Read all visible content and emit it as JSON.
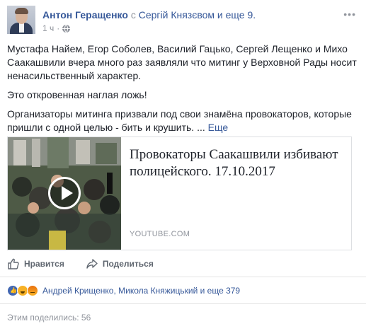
{
  "header": {
    "author": "Антон Геращенко",
    "with_text": "с",
    "tagged": "Сергій Князєвом и еще 9.",
    "time": "1 ч",
    "dot": "·",
    "options": "•••"
  },
  "body": {
    "paragraph1": "Мустафа Найем, Егор Соболев, Василий Гацько, Сергей Лещенко и Михо Саакашвили вчера много раз заявляли что митинг у Верховной Рады носит ненасильственный характер.",
    "paragraph2": "Это откровенная наглая ложь!",
    "paragraph3": "Организаторы митинга призвали под свои знамёна провокаторов, которые пришли с одной целью - бить и крушить. ...",
    "see_more": "Еще"
  },
  "link_card": {
    "title": "Провокаторы Саакашвили избивают полицейского. 17.10.2017",
    "domain": "YOUTUBE.COM"
  },
  "actions": {
    "like_label": "Нравится",
    "share_label": "Поделиться"
  },
  "reactions": {
    "names": "Андрей Крищенко, Микола Княжицький и еще 379"
  },
  "shares": {
    "text": "Этим поделились: 56"
  },
  "colors": {
    "link": "#365899",
    "meta": "#90949c",
    "text": "#1d2129"
  }
}
